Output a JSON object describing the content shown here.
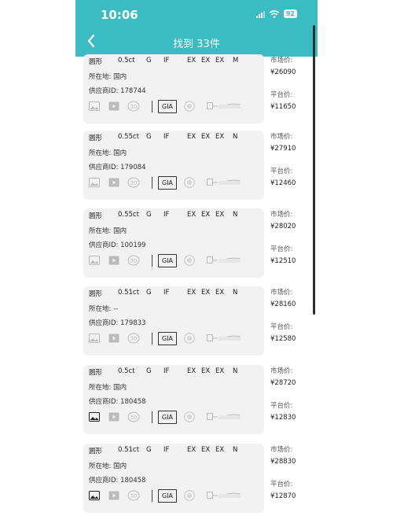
{
  "status": {
    "time": "10:06",
    "battery": "92"
  },
  "nav": {
    "title": "找到 33件"
  },
  "labels": {
    "market": "市场价:",
    "platform": "平台价:",
    "grading": "GIA"
  },
  "items": [
    {
      "shape": "圆形",
      "carat": "0.5ct",
      "color": "G",
      "clarity": "IF",
      "cut": "EX",
      "polish": "EX",
      "symmetry": "EX",
      "fluor": "M",
      "location": "所在地: 国内",
      "supplier": "供应商ID: 178744",
      "market_price": "¥26090",
      "platform_price": "¥11650",
      "image_available": false
    },
    {
      "shape": "圆形",
      "carat": "0.55ct",
      "color": "G",
      "clarity": "IF",
      "cut": "EX",
      "polish": "EX",
      "symmetry": "EX",
      "fluor": "N",
      "location": "所在地: 国内",
      "supplier": "供应商ID: 179084",
      "market_price": "¥27910",
      "platform_price": "¥12460",
      "image_available": false
    },
    {
      "shape": "圆形",
      "carat": "0.55ct",
      "color": "G",
      "clarity": "IF",
      "cut": "EX",
      "polish": "EX",
      "symmetry": "EX",
      "fluor": "N",
      "location": "所在地: 国内",
      "supplier": "供应商ID: 100199",
      "market_price": "¥28020",
      "platform_price": "¥12510",
      "image_available": false
    },
    {
      "shape": "圆形",
      "carat": "0.51ct",
      "color": "G",
      "clarity": "IF",
      "cut": "EX",
      "polish": "EX",
      "symmetry": "EX",
      "fluor": "N",
      "location": "所在地: --",
      "supplier": "供应商ID: 179833",
      "market_price": "¥28160",
      "platform_price": "¥12580",
      "image_available": false
    },
    {
      "shape": "圆形",
      "carat": "0.5ct",
      "color": "G",
      "clarity": "IF",
      "cut": "EX",
      "polish": "EX",
      "symmetry": "EX",
      "fluor": "N",
      "location": "所在地: 国内",
      "supplier": "供应商ID: 180458",
      "market_price": "¥28720",
      "platform_price": "¥12830",
      "image_available": true
    },
    {
      "shape": "圆形",
      "carat": "0.51ct",
      "color": "G",
      "clarity": "IF",
      "cut": "EX",
      "polish": "EX",
      "symmetry": "EX",
      "fluor": "N",
      "location": "所在地: 国内",
      "supplier": "供应商ID: 180458",
      "market_price": "¥28830",
      "platform_price": "¥12870",
      "image_available": true
    }
  ]
}
